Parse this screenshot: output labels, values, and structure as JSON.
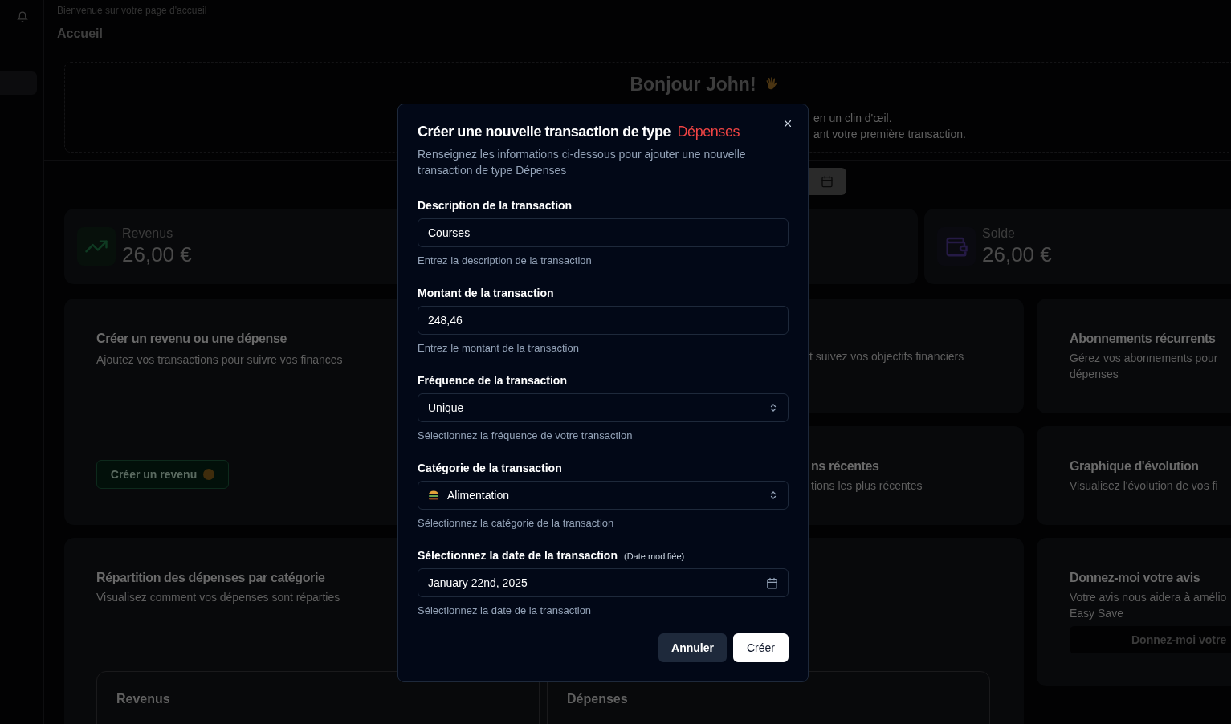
{
  "header": {
    "subtitle": "Bienvenue sur votre page d'accueil",
    "title": "Accueil"
  },
  "hero": {
    "greeting": "Bonjour John!",
    "lines": [
      "en un clin d'œil.",
      "ant votre première transaction."
    ]
  },
  "stats": [
    {
      "kind": "income",
      "label": "Revenus",
      "value": "26,00 €"
    },
    {
      "kind": "balance",
      "label": "Solde",
      "value": "26,00 €"
    }
  ],
  "cards": {
    "create": {
      "title": "Créer un revenu ou une dépense",
      "text": "Ajoutez vos transactions pour suivre vos finances",
      "button": "Créer un revenu"
    },
    "goals": {
      "text": "t suivez vos objectifs financiers"
    },
    "subscriptions": {
      "title": "Abonnements récurrents",
      "lines": [
        "Gérez vos abonnements pour",
        "dépenses"
      ]
    },
    "recent": {
      "title": "ns récentes",
      "text": "tions les plus récentes"
    },
    "evolution": {
      "title": "Graphique d'évolution",
      "text": "Visualisez l'évolution de vos fi"
    },
    "breakdown": {
      "title": "Répartition des dépenses par catégorie",
      "text": "Visualisez comment vos dépenses sont réparties",
      "panels": [
        "Revenus",
        "Dépenses"
      ]
    },
    "feedback": {
      "title": "Donnez-moi votre avis",
      "lines": [
        "Votre avis nous aidera à amélio",
        "Easy Save"
      ],
      "button": "Donnez-moi votre"
    }
  },
  "dialog": {
    "title": "Créer une nouvelle transaction de type",
    "type": "Dépenses",
    "description": "Renseignez les informations ci-dessous pour ajouter une nouvelle transaction de type Dépenses",
    "fields": [
      {
        "kind": "text",
        "label": "Description de la transaction",
        "value": "Courses",
        "hint": "Entrez la description de la transaction"
      },
      {
        "kind": "text",
        "label": "Montant de la transaction",
        "value": "248,46",
        "hint": "Entrez le montant de la transaction"
      },
      {
        "kind": "select",
        "label": "Fréquence de la transaction",
        "value": "Unique",
        "hint": "Sélectionnez la fréquence de votre transaction"
      },
      {
        "kind": "category",
        "label": "Catégorie de la transaction",
        "value": "Alimentation",
        "hint": "Sélectionnez la catégorie de la transaction"
      },
      {
        "kind": "date",
        "label": "Sélectionnez la date de la transaction",
        "note": "(Date modifiée)",
        "value": "January 22nd, 2025",
        "hint": "Sélectionnez la date de la transaction"
      }
    ],
    "buttons": [
      {
        "kind": "secondary",
        "label": "Annuler"
      },
      {
        "kind": "primary",
        "label": "Créer"
      }
    ]
  }
}
